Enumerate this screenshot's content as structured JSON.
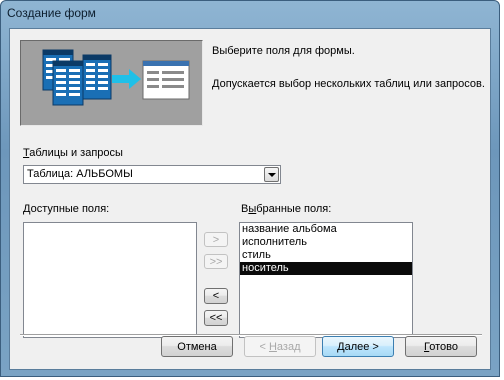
{
  "window": {
    "title": "Создание форм"
  },
  "intro": {
    "line1": "Выберите поля для формы.",
    "line2": "Допускается выбор нескольких таблиц или запросов."
  },
  "tables": {
    "label_u": "Т",
    "label_rest": "аблицы и запросы",
    "selected": "Таблица: АЛЬБОМЫ"
  },
  "available": {
    "label_u": "Д",
    "label_rest": "оступные поля:",
    "items": []
  },
  "selected_fields": {
    "label_pre": "В",
    "label_u": "ы",
    "label_rest": "бранные поля:",
    "items": [
      "название альбома",
      "исполнитель",
      "стиль",
      "носитель"
    ],
    "selected_index": 3
  },
  "move_buttons": {
    "add_one": ">",
    "add_all": ">>",
    "remove_one": "<",
    "remove_all": "<<"
  },
  "footer": {
    "cancel": "Отмена",
    "back_pre": "< ",
    "back_u": "Н",
    "back_rest": "азад",
    "next_u": "Д",
    "next_rest": "алее >",
    "finish_u": "Г",
    "finish_rest": "отово"
  },
  "colors": {
    "titlebar": "#7aa3c4",
    "dialog_bg": "#f0f0f0",
    "selection": "#0a0a0a"
  }
}
